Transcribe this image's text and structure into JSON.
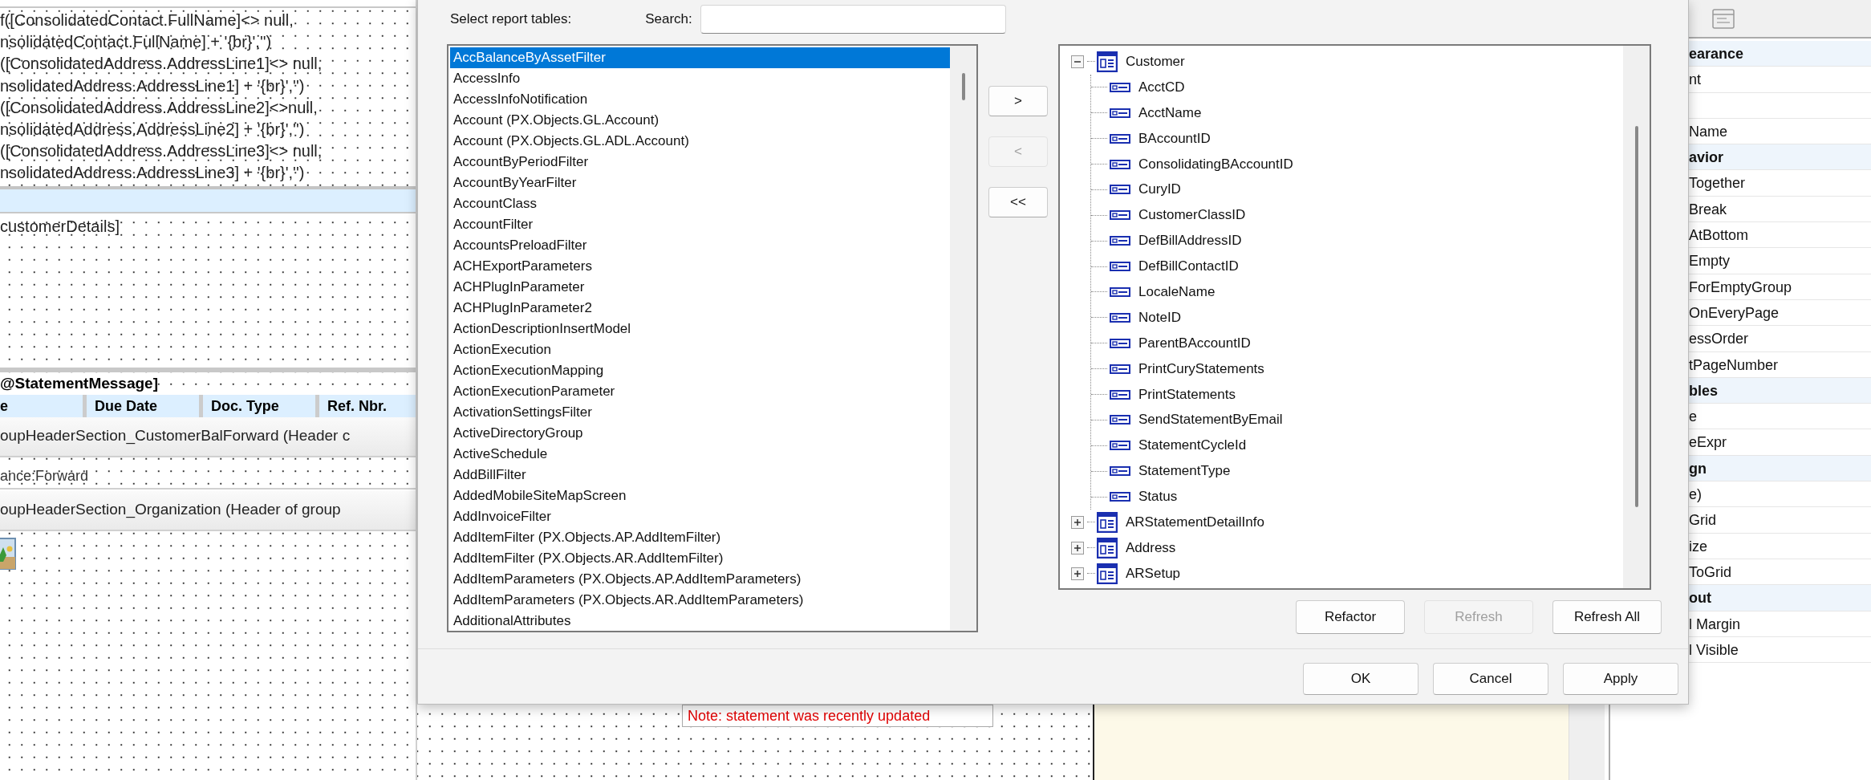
{
  "designer": {
    "expression_lines": [
      "f([ConsolidatedContact.FullName]<> null,",
      "nsolidatedContact.FullName] + '{br}','')",
      "([ConsolidatedAddress.AddressLine1]<> null,",
      "nsolidatedAddress.AddressLine1] + '{br}','')",
      "([ConsolidatedAddress.AddressLine2]<>null,",
      "nsolidatedAddress.AddressLine2] + '{br}','')",
      "([ConsolidatedAddress.AddressLine3]<> null,",
      "nsolidatedAddress.AddressLine3] + '{br}','')"
    ],
    "details_field": "customerDetails]",
    "message_field": "@StatementMessage]",
    "columns": [
      "e",
      "Due Date",
      "Doc. Type",
      "Ref. Nbr."
    ],
    "sections": [
      {
        "kind": "section_header",
        "text": "oupHeaderSection_CustomerBalForward (Header c"
      },
      {
        "kind": "field",
        "text": "ance:Forward"
      },
      {
        "kind": "section_header",
        "text": "oupHeaderSection_Organization (Header of group"
      }
    ],
    "note": "Note: statement was recently updated"
  },
  "dialog": {
    "tables_label": "Select report tables:",
    "search_label": "Search:",
    "tables": [
      {
        "label": "AccBalanceByAssetFilter",
        "selected": true
      },
      {
        "label": "AccessInfo",
        "selected": false
      },
      {
        "label": "AccessInfoNotification",
        "selected": false
      },
      {
        "label": "Account (PX.Objects.GL.Account)",
        "selected": false
      },
      {
        "label": "Account (PX.Objects.GL.ADL.Account)",
        "selected": false
      },
      {
        "label": "AccountByPeriodFilter",
        "selected": false
      },
      {
        "label": "AccountByYearFilter",
        "selected": false
      },
      {
        "label": "AccountClass",
        "selected": false
      },
      {
        "label": "AccountFilter",
        "selected": false
      },
      {
        "label": "AccountsPreloadFilter",
        "selected": false
      },
      {
        "label": "ACHExportParameters",
        "selected": false
      },
      {
        "label": "ACHPlugInParameter",
        "selected": false
      },
      {
        "label": "ACHPlugInParameter2",
        "selected": false
      },
      {
        "label": "ActionDescriptionInsertModel",
        "selected": false
      },
      {
        "label": "ActionExecution",
        "selected": false
      },
      {
        "label": "ActionExecutionMapping",
        "selected": false
      },
      {
        "label": "ActionExecutionParameter",
        "selected": false
      },
      {
        "label": "ActivationSettingsFilter",
        "selected": false
      },
      {
        "label": "ActiveDirectoryGroup",
        "selected": false
      },
      {
        "label": "ActiveSchedule",
        "selected": false
      },
      {
        "label": "AddBillFilter",
        "selected": false
      },
      {
        "label": "AddedMobileSiteMapScreen",
        "selected": false
      },
      {
        "label": "AddInvoiceFilter",
        "selected": false
      },
      {
        "label": "AddItemFilter (PX.Objects.AP.AddItemFilter)",
        "selected": false
      },
      {
        "label": "AddItemFilter (PX.Objects.AR.AddItemFilter)",
        "selected": false
      },
      {
        "label": "AddItemParameters (PX.Objects.AP.AddItemParameters)",
        "selected": false
      },
      {
        "label": "AddItemParameters (PX.Objects.AR.AddItemParameters)",
        "selected": false
      },
      {
        "label": "AdditionalAttributes",
        "selected": false
      }
    ],
    "move_buttons": [
      {
        "label": ">",
        "disabled": false
      },
      {
        "label": "<",
        "disabled": true
      },
      {
        "label": "<<",
        "disabled": false
      }
    ],
    "tree": [
      {
        "kind": "table",
        "label": "Customer",
        "expanded": true,
        "children": [
          {
            "kind": "field",
            "label": "AcctCD"
          },
          {
            "kind": "field",
            "label": "AcctName"
          },
          {
            "kind": "field",
            "label": "BAccountID"
          },
          {
            "kind": "field",
            "label": "ConsolidatingBAccountID"
          },
          {
            "kind": "field",
            "label": "CuryID"
          },
          {
            "kind": "field",
            "label": "CustomerClassID"
          },
          {
            "kind": "field",
            "label": "DefBillAddressID"
          },
          {
            "kind": "field",
            "label": "DefBillContactID"
          },
          {
            "kind": "field",
            "label": "LocaleName"
          },
          {
            "kind": "field",
            "label": "NoteID"
          },
          {
            "kind": "field",
            "label": "ParentBAccountID"
          },
          {
            "kind": "field",
            "label": "PrintCuryStatements"
          },
          {
            "kind": "field",
            "label": "PrintStatements"
          },
          {
            "kind": "field",
            "label": "SendStatementByEmail"
          },
          {
            "kind": "field",
            "label": "StatementCycleId"
          },
          {
            "kind": "field",
            "label": "StatementType"
          },
          {
            "kind": "field",
            "label": "Status"
          }
        ]
      },
      {
        "kind": "table",
        "label": "ARStatementDetailInfo",
        "expanded": false
      },
      {
        "kind": "table",
        "label": "Address",
        "expanded": false
      },
      {
        "kind": "table",
        "label": "ARSetup",
        "expanded": false
      }
    ],
    "tree_buttons": [
      {
        "label": "Refactor",
        "disabled": false
      },
      {
        "label": "Refresh",
        "disabled": true
      },
      {
        "label": "Refresh All",
        "disabled": false
      }
    ],
    "buttons": [
      {
        "label": "OK"
      },
      {
        "label": "Cancel"
      },
      {
        "label": "Apply"
      }
    ]
  },
  "properties": {
    "rows": [
      {
        "kind": "category",
        "label": "earance"
      },
      {
        "kind": "property",
        "label": "nt"
      },
      {
        "kind": "blank"
      },
      {
        "kind": "property",
        "label": "Name"
      },
      {
        "kind": "category",
        "label": "avior"
      },
      {
        "kind": "property",
        "label": "Together"
      },
      {
        "kind": "property",
        "label": "Break"
      },
      {
        "kind": "property",
        "label": "AtBottom"
      },
      {
        "kind": "property",
        "label": "Empty"
      },
      {
        "kind": "property",
        "label": "ForEmptyGroup"
      },
      {
        "kind": "property",
        "label": "OnEveryPage"
      },
      {
        "kind": "property",
        "label": "essOrder"
      },
      {
        "kind": "property",
        "label": "tPageNumber"
      },
      {
        "kind": "category",
        "label": "bles"
      },
      {
        "kind": "property",
        "label": "e"
      },
      {
        "kind": "property",
        "label": "eExpr"
      },
      {
        "kind": "category",
        "label": "gn"
      },
      {
        "kind": "property",
        "label": "e)"
      },
      {
        "kind": "property",
        "label": "Grid"
      },
      {
        "kind": "property",
        "label": "ize"
      },
      {
        "kind": "property",
        "label": "ToGrid"
      },
      {
        "kind": "category",
        "label": "out"
      },
      {
        "kind": "property",
        "label": "l Margin"
      },
      {
        "kind": "property",
        "label": "l Visible"
      }
    ]
  }
}
